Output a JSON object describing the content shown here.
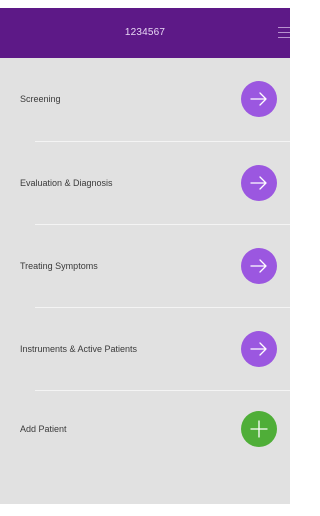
{
  "header": {
    "title": "1234567",
    "menu_icon": "hamburger-icon"
  },
  "menu": {
    "items": [
      {
        "label": "Screening",
        "icon": "arrow-right-icon",
        "color": "#9b57e0"
      },
      {
        "label": "Evaluation & Diagnosis",
        "icon": "arrow-right-icon",
        "color": "#9b57e0"
      },
      {
        "label": "Treating Symptoms",
        "icon": "arrow-right-icon",
        "color": "#9b57e0"
      },
      {
        "label": "Instruments & Active Patients",
        "icon": "arrow-right-icon",
        "color": "#9b57e0"
      },
      {
        "label": "Add Patient",
        "icon": "plus-icon",
        "color": "#4fae38"
      }
    ]
  },
  "colors": {
    "header_bg": "#5d1987",
    "content_bg": "#e1e1e1",
    "accent_purple": "#9b57e0",
    "accent_green": "#4fae38"
  }
}
